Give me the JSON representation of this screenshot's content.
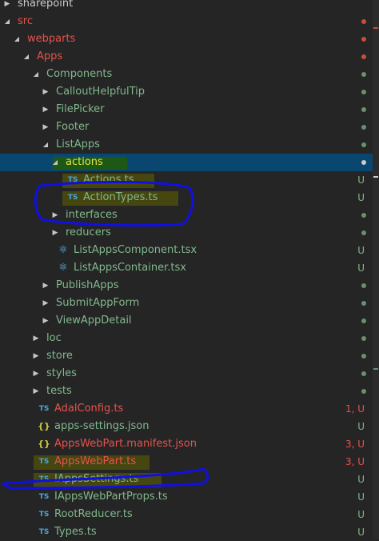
{
  "colors": {
    "background": "#252526",
    "selection": "#094771",
    "folder_text": "#81b88b",
    "modified_text": "#e8524b",
    "untracked_text": "#e6d84a",
    "ts_icon": "#4aa6d6",
    "annotation": "#1010e0"
  },
  "tree": [
    {
      "label": "sharepoint",
      "depth": 0,
      "type": "folder",
      "open": false,
      "color": "white",
      "badge": "",
      "dot": ""
    },
    {
      "label": "src",
      "depth": 0,
      "type": "folder",
      "open": true,
      "color": "red",
      "badge": "",
      "dot": "#c74e39"
    },
    {
      "label": "webparts",
      "depth": 1,
      "type": "folder",
      "open": true,
      "color": "red",
      "badge": "",
      "dot": "#c74e39"
    },
    {
      "label": "Apps",
      "depth": 2,
      "type": "folder",
      "open": true,
      "color": "red",
      "badge": "",
      "dot": "#c74e39"
    },
    {
      "label": "Components",
      "depth": 3,
      "type": "folder",
      "open": true,
      "color": "green",
      "badge": "",
      "dot": "#6b8f6f"
    },
    {
      "label": "CalloutHelpfulTip",
      "depth": 4,
      "type": "folder",
      "open": false,
      "color": "green",
      "badge": "",
      "dot": "#6b8f6f"
    },
    {
      "label": "FilePicker",
      "depth": 4,
      "type": "folder",
      "open": false,
      "color": "green",
      "badge": "",
      "dot": "#6b8f6f"
    },
    {
      "label": "Footer",
      "depth": 4,
      "type": "folder",
      "open": false,
      "color": "green",
      "badge": "",
      "dot": "#6b8f6f"
    },
    {
      "label": "ListApps",
      "depth": 4,
      "type": "folder",
      "open": true,
      "color": "green",
      "badge": "",
      "dot": "#6b8f6f"
    },
    {
      "label": "actions",
      "depth": 5,
      "type": "folder",
      "open": true,
      "color": "selected",
      "badge": "",
      "dot": "#cccccc",
      "selected": true,
      "hl": "green"
    },
    {
      "label": "Actions.ts",
      "depth": 6,
      "type": "ts",
      "color": "green",
      "badge": "U",
      "dot": "",
      "hl": "olive"
    },
    {
      "label": "ActionTypes.ts",
      "depth": 6,
      "type": "ts",
      "color": "green",
      "badge": "U",
      "dot": "",
      "hl": "olive"
    },
    {
      "label": "interfaces",
      "depth": 5,
      "type": "folder",
      "open": false,
      "color": "green",
      "badge": "",
      "dot": "#6b8f6f"
    },
    {
      "label": "reducers",
      "depth": 5,
      "type": "folder",
      "open": false,
      "color": "green",
      "badge": "",
      "dot": "#6b8f6f"
    },
    {
      "label": "ListAppsComponent.tsx",
      "depth": 5,
      "type": "react",
      "color": "green",
      "badge": "U",
      "dot": ""
    },
    {
      "label": "ListAppsContainer.tsx",
      "depth": 5,
      "type": "react",
      "color": "green",
      "badge": "U",
      "dot": ""
    },
    {
      "label": "PublishApps",
      "depth": 4,
      "type": "folder",
      "open": false,
      "color": "green",
      "badge": "",
      "dot": "#6b8f6f"
    },
    {
      "label": "SubmitAppForm",
      "depth": 4,
      "type": "folder",
      "open": false,
      "color": "green",
      "badge": "",
      "dot": "#6b8f6f"
    },
    {
      "label": "ViewAppDetail",
      "depth": 4,
      "type": "folder",
      "open": false,
      "color": "green",
      "badge": "",
      "dot": "#6b8f6f"
    },
    {
      "label": "loc",
      "depth": 3,
      "type": "folder",
      "open": false,
      "color": "green",
      "badge": "",
      "dot": "#6b8f6f"
    },
    {
      "label": "store",
      "depth": 3,
      "type": "folder",
      "open": false,
      "color": "green",
      "badge": "",
      "dot": "#6b8f6f"
    },
    {
      "label": "styles",
      "depth": 3,
      "type": "folder",
      "open": false,
      "color": "green",
      "badge": "",
      "dot": "#6b8f6f"
    },
    {
      "label": "tests",
      "depth": 3,
      "type": "folder",
      "open": false,
      "color": "green",
      "badge": "",
      "dot": "#6b8f6f"
    },
    {
      "label": "AdalConfig.ts",
      "depth": 3,
      "type": "ts",
      "color": "red",
      "badge": "1, U",
      "dot": ""
    },
    {
      "label": "apps-settings.json",
      "depth": 3,
      "type": "json",
      "color": "green",
      "badge": "U",
      "dot": ""
    },
    {
      "label": "AppsWebPart.manifest.json",
      "depth": 3,
      "type": "json",
      "color": "red",
      "badge": "3, U",
      "dot": ""
    },
    {
      "label": "AppsWebPart.ts",
      "depth": 3,
      "type": "ts",
      "color": "red",
      "badge": "3, U",
      "dot": "",
      "hl": "olive"
    },
    {
      "label": "IAppsSettings.ts",
      "depth": 3,
      "type": "ts",
      "color": "green",
      "badge": "U",
      "dot": "",
      "hl": "olive"
    },
    {
      "label": "IAppsWebPartProps.ts",
      "depth": 3,
      "type": "ts",
      "color": "green",
      "badge": "U",
      "dot": ""
    },
    {
      "label": "RootReducer.ts",
      "depth": 3,
      "type": "ts",
      "color": "green",
      "badge": "U",
      "dot": ""
    },
    {
      "label": "Types.ts",
      "depth": 3,
      "type": "ts",
      "color": "green",
      "badge": "U",
      "dot": ""
    }
  ],
  "icons": {
    "folder_open": "chevron-down-icon",
    "folder_closed": "chevron-right-icon",
    "ts": "typescript-icon",
    "json": "json-icon",
    "react": "react-icon"
  }
}
